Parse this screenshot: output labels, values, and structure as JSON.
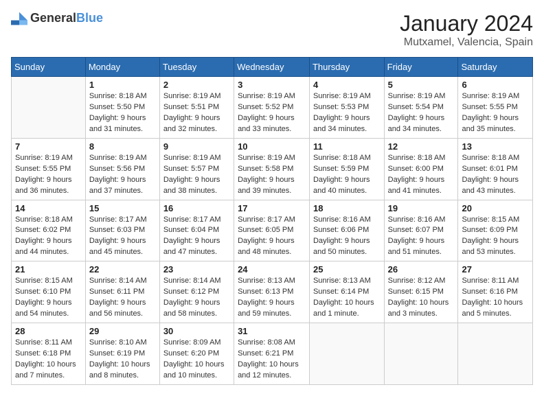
{
  "header": {
    "logo_general": "General",
    "logo_blue": "Blue",
    "title": "January 2024",
    "subtitle": "Mutxamel, Valencia, Spain"
  },
  "calendar": {
    "days_of_week": [
      "Sunday",
      "Monday",
      "Tuesday",
      "Wednesday",
      "Thursday",
      "Friday",
      "Saturday"
    ],
    "weeks": [
      [
        {
          "day": "",
          "info": ""
        },
        {
          "day": "1",
          "info": "Sunrise: 8:18 AM\nSunset: 5:50 PM\nDaylight: 9 hours\nand 31 minutes."
        },
        {
          "day": "2",
          "info": "Sunrise: 8:19 AM\nSunset: 5:51 PM\nDaylight: 9 hours\nand 32 minutes."
        },
        {
          "day": "3",
          "info": "Sunrise: 8:19 AM\nSunset: 5:52 PM\nDaylight: 9 hours\nand 33 minutes."
        },
        {
          "day": "4",
          "info": "Sunrise: 8:19 AM\nSunset: 5:53 PM\nDaylight: 9 hours\nand 34 minutes."
        },
        {
          "day": "5",
          "info": "Sunrise: 8:19 AM\nSunset: 5:54 PM\nDaylight: 9 hours\nand 34 minutes."
        },
        {
          "day": "6",
          "info": "Sunrise: 8:19 AM\nSunset: 5:55 PM\nDaylight: 9 hours\nand 35 minutes."
        }
      ],
      [
        {
          "day": "7",
          "info": "Sunrise: 8:19 AM\nSunset: 5:55 PM\nDaylight: 9 hours\nand 36 minutes."
        },
        {
          "day": "8",
          "info": "Sunrise: 8:19 AM\nSunset: 5:56 PM\nDaylight: 9 hours\nand 37 minutes."
        },
        {
          "day": "9",
          "info": "Sunrise: 8:19 AM\nSunset: 5:57 PM\nDaylight: 9 hours\nand 38 minutes."
        },
        {
          "day": "10",
          "info": "Sunrise: 8:19 AM\nSunset: 5:58 PM\nDaylight: 9 hours\nand 39 minutes."
        },
        {
          "day": "11",
          "info": "Sunrise: 8:18 AM\nSunset: 5:59 PM\nDaylight: 9 hours\nand 40 minutes."
        },
        {
          "day": "12",
          "info": "Sunrise: 8:18 AM\nSunset: 6:00 PM\nDaylight: 9 hours\nand 41 minutes."
        },
        {
          "day": "13",
          "info": "Sunrise: 8:18 AM\nSunset: 6:01 PM\nDaylight: 9 hours\nand 43 minutes."
        }
      ],
      [
        {
          "day": "14",
          "info": "Sunrise: 8:18 AM\nSunset: 6:02 PM\nDaylight: 9 hours\nand 44 minutes."
        },
        {
          "day": "15",
          "info": "Sunrise: 8:17 AM\nSunset: 6:03 PM\nDaylight: 9 hours\nand 45 minutes."
        },
        {
          "day": "16",
          "info": "Sunrise: 8:17 AM\nSunset: 6:04 PM\nDaylight: 9 hours\nand 47 minutes."
        },
        {
          "day": "17",
          "info": "Sunrise: 8:17 AM\nSunset: 6:05 PM\nDaylight: 9 hours\nand 48 minutes."
        },
        {
          "day": "18",
          "info": "Sunrise: 8:16 AM\nSunset: 6:06 PM\nDaylight: 9 hours\nand 50 minutes."
        },
        {
          "day": "19",
          "info": "Sunrise: 8:16 AM\nSunset: 6:07 PM\nDaylight: 9 hours\nand 51 minutes."
        },
        {
          "day": "20",
          "info": "Sunrise: 8:15 AM\nSunset: 6:09 PM\nDaylight: 9 hours\nand 53 minutes."
        }
      ],
      [
        {
          "day": "21",
          "info": "Sunrise: 8:15 AM\nSunset: 6:10 PM\nDaylight: 9 hours\nand 54 minutes."
        },
        {
          "day": "22",
          "info": "Sunrise: 8:14 AM\nSunset: 6:11 PM\nDaylight: 9 hours\nand 56 minutes."
        },
        {
          "day": "23",
          "info": "Sunrise: 8:14 AM\nSunset: 6:12 PM\nDaylight: 9 hours\nand 58 minutes."
        },
        {
          "day": "24",
          "info": "Sunrise: 8:13 AM\nSunset: 6:13 PM\nDaylight: 9 hours\nand 59 minutes."
        },
        {
          "day": "25",
          "info": "Sunrise: 8:13 AM\nSunset: 6:14 PM\nDaylight: 10 hours\nand 1 minute."
        },
        {
          "day": "26",
          "info": "Sunrise: 8:12 AM\nSunset: 6:15 PM\nDaylight: 10 hours\nand 3 minutes."
        },
        {
          "day": "27",
          "info": "Sunrise: 8:11 AM\nSunset: 6:16 PM\nDaylight: 10 hours\nand 5 minutes."
        }
      ],
      [
        {
          "day": "28",
          "info": "Sunrise: 8:11 AM\nSunset: 6:18 PM\nDaylight: 10 hours\nand 7 minutes."
        },
        {
          "day": "29",
          "info": "Sunrise: 8:10 AM\nSunset: 6:19 PM\nDaylight: 10 hours\nand 8 minutes."
        },
        {
          "day": "30",
          "info": "Sunrise: 8:09 AM\nSunset: 6:20 PM\nDaylight: 10 hours\nand 10 minutes."
        },
        {
          "day": "31",
          "info": "Sunrise: 8:08 AM\nSunset: 6:21 PM\nDaylight: 10 hours\nand 12 minutes."
        },
        {
          "day": "",
          "info": ""
        },
        {
          "day": "",
          "info": ""
        },
        {
          "day": "",
          "info": ""
        }
      ]
    ]
  }
}
